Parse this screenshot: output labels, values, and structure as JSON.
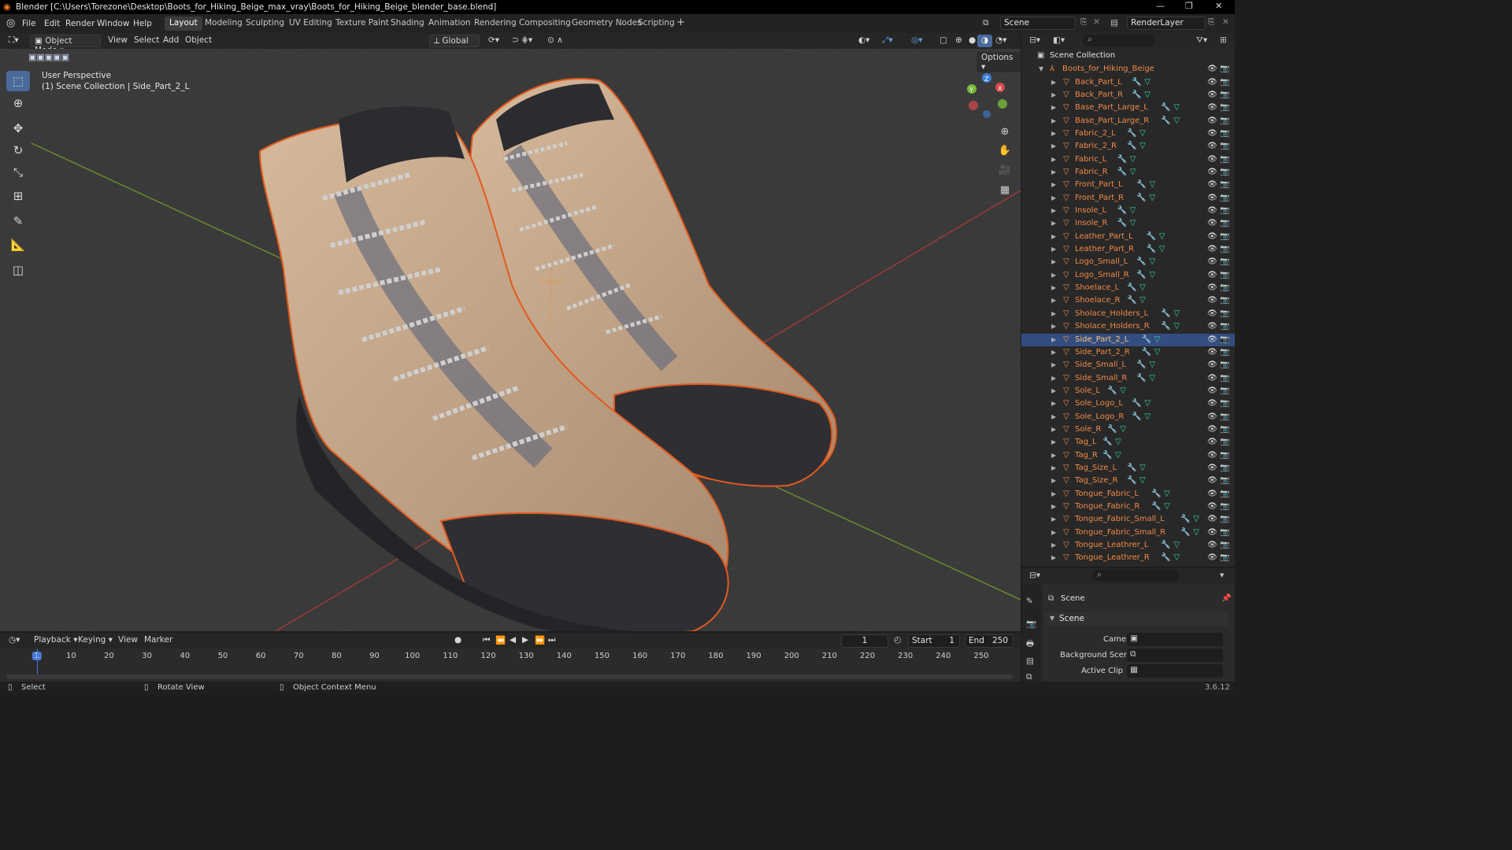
{
  "window": {
    "title": "Blender [C:\\Users\\Torezone\\Desktop\\Boots_for_Hiking_Beige_max_vray\\Boots_for_Hiking_Beige_blender_base.blend]"
  },
  "menu": {
    "file": "File",
    "edit": "Edit",
    "render": "Render",
    "window": "Window",
    "help": "Help"
  },
  "workspaces": [
    "Layout",
    "Modeling",
    "Sculpting",
    "UV Editing",
    "Texture Paint",
    "Shading",
    "Animation",
    "Rendering",
    "Compositing",
    "Geometry Nodes",
    "Scripting"
  ],
  "top_right": {
    "scene": "Scene",
    "render_layer": "RenderLayer"
  },
  "viewport_header": {
    "mode": "Object Mode",
    "view": "View",
    "select": "Select",
    "add": "Add",
    "object": "Object",
    "orientation": "Global",
    "options": "Options"
  },
  "viewport": {
    "perspective": "User Perspective",
    "context": "(1) Scene Collection | Side_Part_2_L",
    "gizmo": {
      "x": "X",
      "y": "Y",
      "z": "Z"
    }
  },
  "outliner": {
    "root": "Scene Collection",
    "collection": "Boots_for_Hiking_Beige",
    "items": [
      "Back_Part_L",
      "Back_Part_R",
      "Base_Part_Large_L",
      "Base_Part_Large_R",
      "Fabric_2_L",
      "Fabric_2_R",
      "Fabric_L",
      "Fabric_R",
      "Front_Part_L",
      "Front_Part_R",
      "Insole_L",
      "Insole_R",
      "Leather_Part_L",
      "Leather_Part_R",
      "Logo_Small_L",
      "Logo_Small_R",
      "Shoelace_L",
      "Shoelace_R",
      "Sholace_Holders_L",
      "Sholace_Holders_R",
      "Side_Part_2_L",
      "Side_Part_2_R",
      "Side_Small_L",
      "Side_Small_R",
      "Sole_L",
      "Sole_Logo_L",
      "Sole_Logo_R",
      "Sole_R",
      "Tag_L",
      "Tag_R",
      "Tag_Size_L",
      "Tag_Size_R",
      "Tongue_Fabric_L",
      "Tongue_Fabric_R",
      "Tongue_Fabric_Small_L",
      "Tongue_Fabric_Small_R",
      "Tongue_Leathrer_L",
      "Tongue_Leathrer_R"
    ],
    "selected": "Side_Part_2_L"
  },
  "properties": {
    "scene_title": "Scene",
    "panel": "Scene",
    "camera_label": "Camera",
    "background_label": "Background Scene",
    "clip_label": "Active Clip"
  },
  "timeline": {
    "playback": "Playback",
    "keying": "Keying",
    "view": "View",
    "marker": "Marker",
    "current_frame": "1",
    "start_label": "Start",
    "start": "1",
    "end_label": "End",
    "end": "250",
    "ticks": [
      "1",
      "10",
      "20",
      "30",
      "40",
      "50",
      "60",
      "70",
      "80",
      "90",
      "100",
      "110",
      "120",
      "130",
      "140",
      "150",
      "160",
      "170",
      "180",
      "190",
      "200",
      "210",
      "220",
      "230",
      "240",
      "250"
    ]
  },
  "status": {
    "select": "Select",
    "rotate": "Rotate View",
    "context": "Object Context Menu",
    "version": "3.6.12"
  }
}
